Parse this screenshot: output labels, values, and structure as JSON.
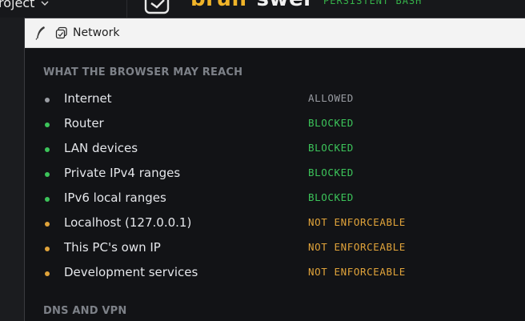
{
  "background": {
    "project_label": "roject",
    "brand_part1": "bruh",
    "brand_part2": "swer",
    "badge": "PERSISTENT BASH"
  },
  "window": {
    "title": "Network",
    "app_icon": "feather-icon",
    "title_icon": "network-panel-icon"
  },
  "section1": {
    "heading": "WHAT THE BROWSER MAY REACH",
    "items": [
      {
        "label": "Internet",
        "status": "ALLOWED",
        "dot_color": "#9a9da3",
        "status_color": "#9a9da3"
      },
      {
        "label": "Router",
        "status": "BLOCKED",
        "dot_color": "#3cc45a",
        "status_color": "#3cc45a"
      },
      {
        "label": "LAN devices",
        "status": "BLOCKED",
        "dot_color": "#3cc45a",
        "status_color": "#3cc45a"
      },
      {
        "label": "Private IPv4 ranges",
        "status": "BLOCKED",
        "dot_color": "#3cc45a",
        "status_color": "#3cc45a"
      },
      {
        "label": "IPv6 local ranges",
        "status": "BLOCKED",
        "dot_color": "#3cc45a",
        "status_color": "#3cc45a"
      },
      {
        "label": "Localhost (127.0.0.1)",
        "status": "NOT ENFORCEABLE",
        "dot_color": "#e0a33a",
        "status_color": "#e0a33a"
      },
      {
        "label": "This PC's own IP",
        "status": "NOT ENFORCEABLE",
        "dot_color": "#e0a33a",
        "status_color": "#e0a33a"
      },
      {
        "label": "Development services",
        "status": "NOT ENFORCEABLE",
        "dot_color": "#e0a33a",
        "status_color": "#e0a33a"
      }
    ]
  },
  "section2": {
    "heading": "DNS AND VPN"
  }
}
